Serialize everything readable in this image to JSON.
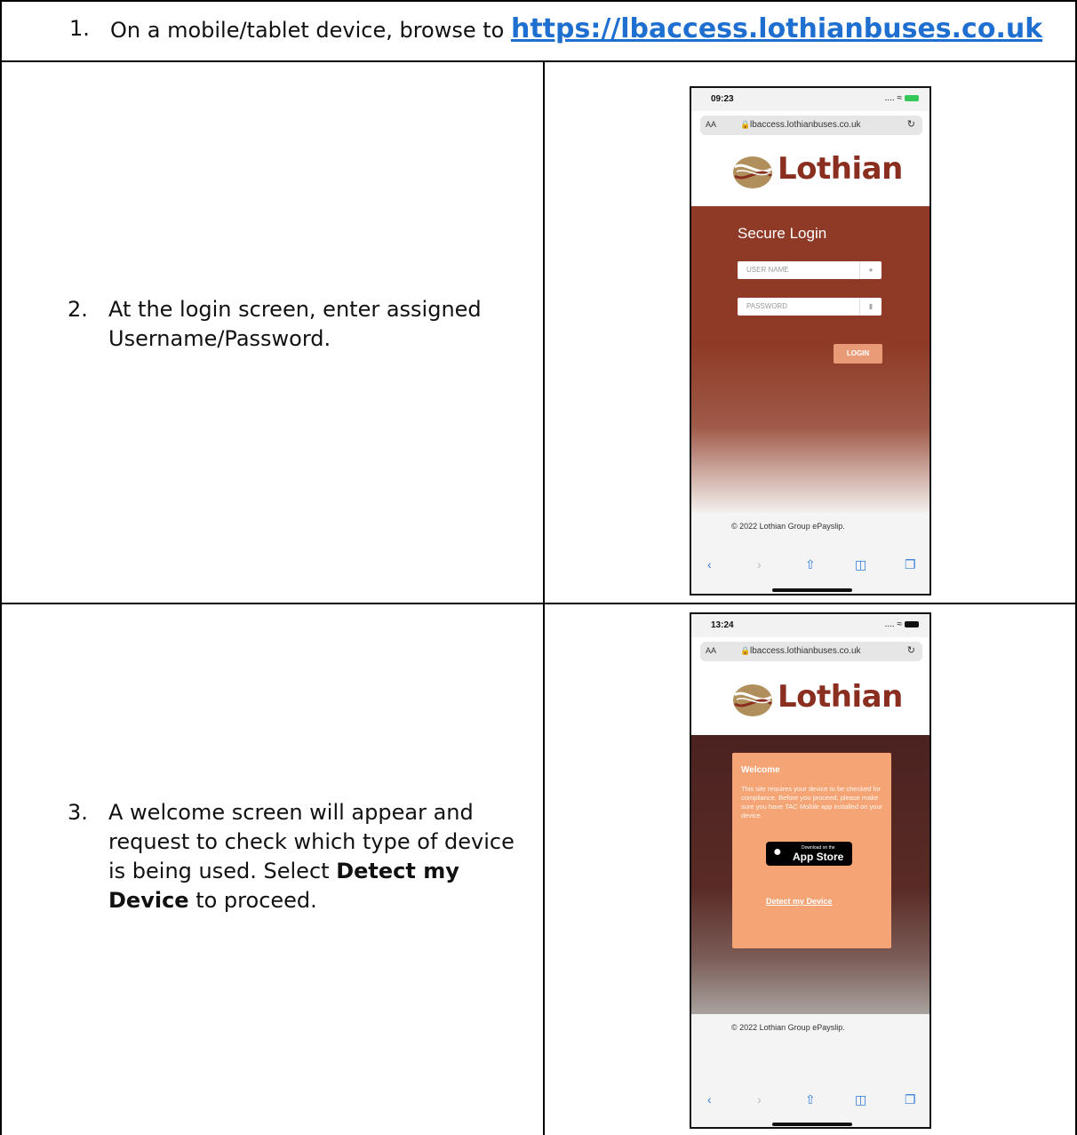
{
  "steps": {
    "s1": {
      "num": "1.",
      "text": "On a mobile/tablet device, browse to ",
      "link": "https://lbaccess.lothianbuses.co.uk"
    },
    "s2": {
      "num": "2.",
      "text": "At the login screen, enter assigned Username/Password."
    },
    "s3": {
      "num": "3.",
      "text_a": "A welcome screen will appear and request to check which type of device is being used. Select ",
      "bold": "Detect my Device",
      "text_b": " to proceed."
    }
  },
  "phone1": {
    "time": "09:23",
    "signal": "....",
    "aa": "AA",
    "url": "lbaccess.lothianbuses.co.uk",
    "brand": "Lothian",
    "login_title": "Secure Login",
    "username_placeholder": "USER NAME",
    "password_placeholder": "PASSWORD",
    "login_button": "LOGIN",
    "copyright": "© 2022 Lothian Group ePayslip."
  },
  "phone2": {
    "time": "13:24",
    "signal": "....",
    "aa": "AA",
    "url": "lbaccess.lothianbuses.co.uk",
    "brand": "Lothian",
    "welcome_title": "Welcome",
    "welcome_body_a": "This site requires your device to be checked for compliance. Before you proceed, please make sure you have ",
    "welcome_body_app": "TAC Mobile",
    "welcome_body_b": " app installed on your device.",
    "appstore_small": "Download on the",
    "appstore_big": "App Store",
    "detect_link": "Detect my Device",
    "copyright": "© 2022 Lothian Group ePayslip."
  },
  "icons": {
    "lock": "lock-icon",
    "reload": "reload-icon",
    "back": "chevron-left-icon",
    "forward": "chevron-right-icon",
    "share": "share-icon",
    "bookmarks": "bookmarks-icon",
    "tabs": "tabs-icon",
    "user": "user-icon",
    "apple": "apple-icon"
  },
  "colors": {
    "link": "#1f6fd1",
    "brand": "#8a2e1f",
    "login_hero": "#8e3a26",
    "welcome_card": "#f4a475",
    "login_button": "#e89b76",
    "ios_blue": "#2f7bd8"
  }
}
